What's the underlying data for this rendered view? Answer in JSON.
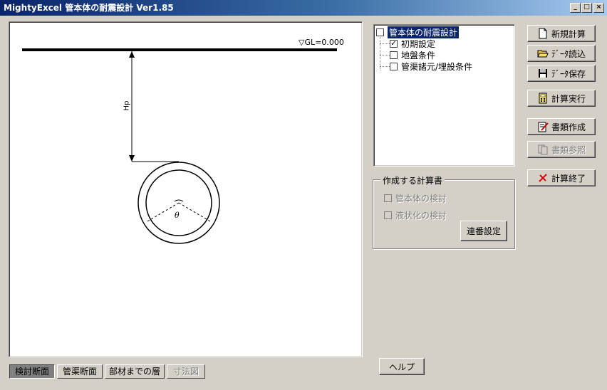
{
  "window": {
    "title": "MightyExcel 管本体の耐震設計 Ver1.85",
    "minimize_glyph": "_",
    "maximize_glyph": "□",
    "close_glyph": "×"
  },
  "drawing": {
    "gl_label": "▽GL=0.000",
    "depth_label": "Hp",
    "angle_label": "θ"
  },
  "tree": {
    "root": {
      "label": "管本体の耐震設計",
      "checked": false
    },
    "items": [
      {
        "label": "初期設定",
        "checked": true
      },
      {
        "label": "地盤条件",
        "checked": false
      },
      {
        "label": "管渠諸元/埋設条件",
        "checked": false
      }
    ]
  },
  "report_group": {
    "title": "作成する計算書",
    "options": [
      {
        "label": "管本体の検討"
      },
      {
        "label": "液状化の検討"
      }
    ],
    "serial_button": "連番設定"
  },
  "buttons": {
    "new_calc": "新規計算",
    "load_data": "ﾃﾞｰﾀ読込",
    "save_data": "ﾃﾞｰﾀ保存",
    "run_calc": "計算実行",
    "make_docs": "書類作成",
    "view_docs": "書類参照",
    "exit_calc": "計算終了",
    "help": "ヘルプ"
  },
  "tabs": [
    "検討断面",
    "管渠断面",
    "部材までの層",
    "寸法図"
  ],
  "icons": {
    "new_calc": "new-document-icon",
    "load_data": "open-folder-icon",
    "save_data": "floppy-disk-icon",
    "run_calc": "calculator-icon",
    "make_docs": "edit-document-icon",
    "view_docs": "view-document-icon",
    "exit_calc": "red-x-icon"
  }
}
